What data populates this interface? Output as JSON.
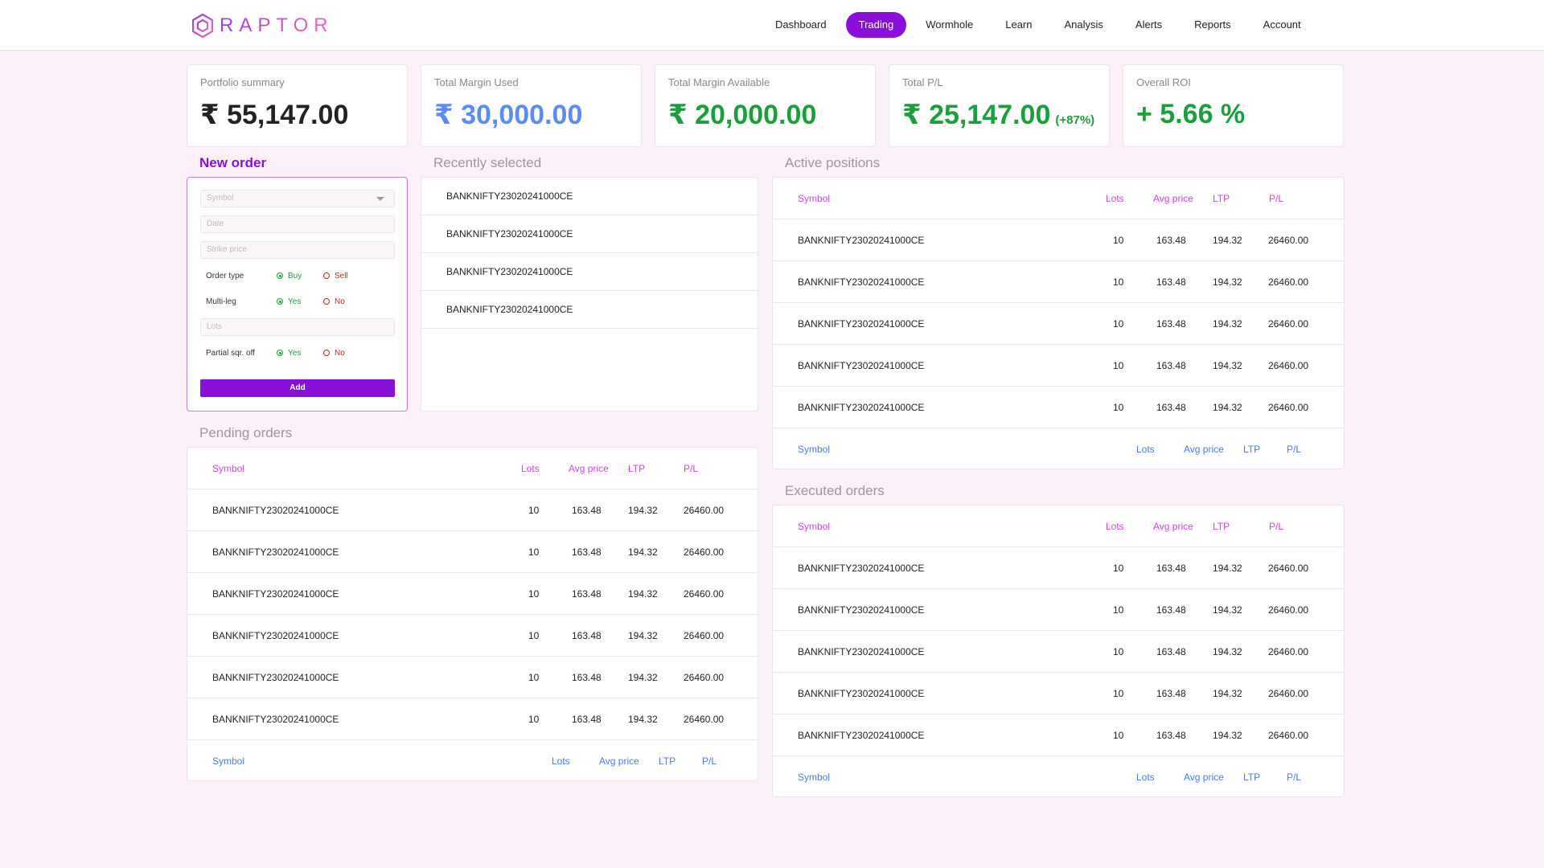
{
  "brand": {
    "name": "RAPTOR"
  },
  "nav": {
    "items": [
      {
        "label": "Dashboard",
        "active": false
      },
      {
        "label": "Trading",
        "active": true
      },
      {
        "label": "Wormhole",
        "active": false
      },
      {
        "label": "Learn",
        "active": false
      },
      {
        "label": "Analysis",
        "active": false
      },
      {
        "label": "Alerts",
        "active": false
      },
      {
        "label": "Reports",
        "active": false
      },
      {
        "label": "Account",
        "active": false
      }
    ]
  },
  "summary": {
    "portfolio": {
      "label": "Portfolio summary",
      "value": "₹ 55,147.00"
    },
    "margin_used": {
      "label": "Total Margin Used",
      "value": "₹ 30,000.00"
    },
    "margin_available": {
      "label": "Total Margin Available",
      "value": "₹ 20,000.00"
    },
    "total_pl": {
      "label": "Total P/L",
      "value": "₹ 25,147.00",
      "sub": "(+87%)"
    },
    "roi": {
      "label": "Overall ROI",
      "value": "+ 5.66 %"
    }
  },
  "new_order": {
    "title": "New order",
    "symbol_placeholder": "Symbol",
    "date_placeholder": "Date",
    "strike_placeholder": "Strike price",
    "lots_placeholder": "Lots",
    "order_type": {
      "label": "Order type",
      "opt1": "Buy",
      "opt2": "Sell",
      "selected": "Buy"
    },
    "multi_leg": {
      "label": "Multi-leg",
      "opt1": "Yes",
      "opt2": "No",
      "selected": "Yes"
    },
    "partial_sqr_off": {
      "label": "Partial sqr. off",
      "opt1": "Yes",
      "opt2": "No",
      "selected": "Yes"
    },
    "add_label": "Add"
  },
  "recent": {
    "title": "Recently selected",
    "items": [
      "BANKNIFTY23020241000CE",
      "BANKNIFTY23020241000CE",
      "BANKNIFTY23020241000CE",
      "BANKNIFTY23020241000CE"
    ]
  },
  "columns": {
    "symbol": "Symbol",
    "lots": "Lots",
    "avg": "Avg price",
    "ltp": "LTP",
    "pl": "P/L"
  },
  "pending": {
    "title": "Pending orders",
    "rows": [
      {
        "symbol": "BANKNIFTY23020241000CE",
        "lots": "10",
        "avg": "163.48",
        "ltp": "194.32",
        "pl": "26460.00"
      },
      {
        "symbol": "BANKNIFTY23020241000CE",
        "lots": "10",
        "avg": "163.48",
        "ltp": "194.32",
        "pl": "26460.00"
      },
      {
        "symbol": "BANKNIFTY23020241000CE",
        "lots": "10",
        "avg": "163.48",
        "ltp": "194.32",
        "pl": "26460.00"
      },
      {
        "symbol": "BANKNIFTY23020241000CE",
        "lots": "10",
        "avg": "163.48",
        "ltp": "194.32",
        "pl": "26460.00"
      },
      {
        "symbol": "BANKNIFTY23020241000CE",
        "lots": "10",
        "avg": "163.48",
        "ltp": "194.32",
        "pl": "26460.00"
      },
      {
        "symbol": "BANKNIFTY23020241000CE",
        "lots": "10",
        "avg": "163.48",
        "ltp": "194.32",
        "pl": "26460.00"
      }
    ]
  },
  "active": {
    "title": "Active positions",
    "rows": [
      {
        "symbol": "BANKNIFTY23020241000CE",
        "lots": "10",
        "avg": "163.48",
        "ltp": "194.32",
        "pl": "26460.00"
      },
      {
        "symbol": "BANKNIFTY23020241000CE",
        "lots": "10",
        "avg": "163.48",
        "ltp": "194.32",
        "pl": "26460.00"
      },
      {
        "symbol": "BANKNIFTY23020241000CE",
        "lots": "10",
        "avg": "163.48",
        "ltp": "194.32",
        "pl": "26460.00"
      },
      {
        "symbol": "BANKNIFTY23020241000CE",
        "lots": "10",
        "avg": "163.48",
        "ltp": "194.32",
        "pl": "26460.00"
      },
      {
        "symbol": "BANKNIFTY23020241000CE",
        "lots": "10",
        "avg": "163.48",
        "ltp": "194.32",
        "pl": "26460.00"
      }
    ]
  },
  "executed": {
    "title": "Executed orders",
    "rows": [
      {
        "symbol": "BANKNIFTY23020241000CE",
        "lots": "10",
        "avg": "163.48",
        "ltp": "194.32",
        "pl": "26460.00"
      },
      {
        "symbol": "BANKNIFTY23020241000CE",
        "lots": "10",
        "avg": "163.48",
        "ltp": "194.32",
        "pl": "26460.00"
      },
      {
        "symbol": "BANKNIFTY23020241000CE",
        "lots": "10",
        "avg": "163.48",
        "ltp": "194.32",
        "pl": "26460.00"
      },
      {
        "symbol": "BANKNIFTY23020241000CE",
        "lots": "10",
        "avg": "163.48",
        "ltp": "194.32",
        "pl": "26460.00"
      },
      {
        "symbol": "BANKNIFTY23020241000CE",
        "lots": "10",
        "avg": "163.48",
        "ltp": "194.32",
        "pl": "26460.00"
      }
    ]
  }
}
